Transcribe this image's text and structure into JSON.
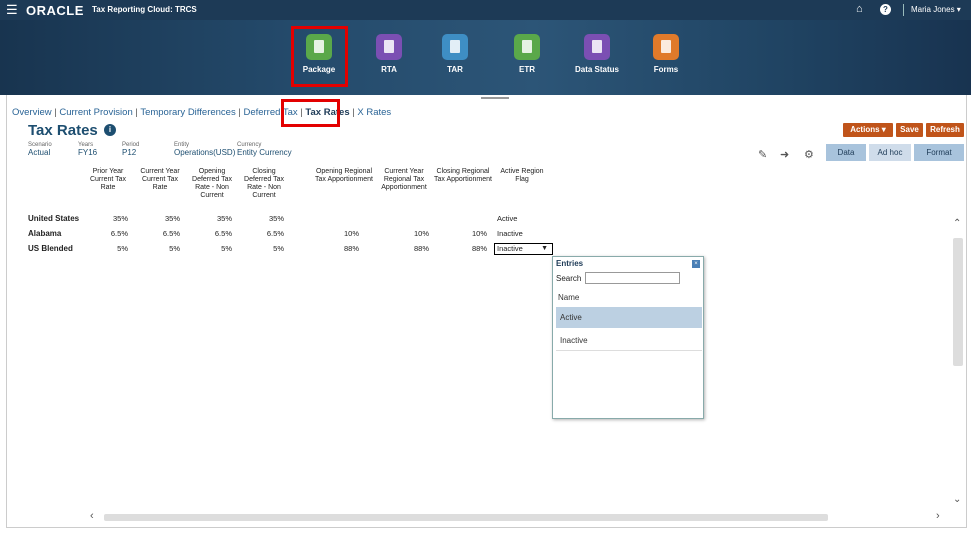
{
  "topbar": {
    "brand": "ORACLE",
    "app_title": "Tax Reporting Cloud: TRCS",
    "user": "Maria Jones ▾",
    "home_icon": "home-icon",
    "help_icon": "help-icon"
  },
  "nav": {
    "tiles": [
      {
        "label": "Package",
        "color": "#5aa84a"
      },
      {
        "label": "RTA",
        "color": "#7b4fb3"
      },
      {
        "label": "TAR",
        "color": "#3e8ec4"
      },
      {
        "label": "ETR",
        "color": "#5aa84a"
      },
      {
        "label": "Data Status",
        "color": "#7b4fb3"
      },
      {
        "label": "Forms",
        "color": "#e07a2a"
      }
    ]
  },
  "tabs": {
    "t1": "Overview",
    "t2": "Current Provision",
    "t3": "Temporary Differences",
    "t4": "Deferred Tax",
    "t5": "Tax Rates",
    "t6": "X Rates",
    "sep": " | "
  },
  "page": {
    "title": "Tax Rates"
  },
  "buttons": {
    "actions": "Actions ▾",
    "save": "Save",
    "refresh": "Refresh",
    "data": "Data",
    "adhoc": "Ad hoc",
    "format": "Format"
  },
  "pov": [
    {
      "label": "Scenario",
      "value": "Actual"
    },
    {
      "label": "Years",
      "value": "FY16"
    },
    {
      "label": "Period",
      "value": "P12"
    },
    {
      "label": "Entity",
      "value": "Operations(USD)"
    },
    {
      "label": "Currency",
      "value": "Entity Currency"
    }
  ],
  "grid": {
    "columns": [
      "Prior Year Current Tax Rate",
      "Current Year Current Tax Rate",
      "Opening Deferred Tax Rate - Non Current",
      "Closing Deferred Tax Rate - Non Current",
      "Opening Regional Tax Apportionment",
      "Current Year Regional Tax Apportionment",
      "Closing Regional Tax Apportionment",
      "Active Region Flag"
    ],
    "rows": [
      {
        "name": "United States",
        "values": [
          "35%",
          "35%",
          "35%",
          "35%",
          "",
          "",
          ""
        ],
        "flag": "Active"
      },
      {
        "name": "Alabama",
        "values": [
          "6.5%",
          "6.5%",
          "6.5%",
          "6.5%",
          "10%",
          "10%",
          "10%"
        ],
        "flag": "Inactive"
      },
      {
        "name": "US Blended",
        "values": [
          "5%",
          "5%",
          "5%",
          "5%",
          "88%",
          "88%",
          "88%"
        ],
        "flag": "Inactive"
      }
    ]
  },
  "dropdown": {
    "title": "Entries",
    "search_label": "Search",
    "search_value": "",
    "header": "Name",
    "options": [
      "Active",
      "Inactive"
    ]
  }
}
